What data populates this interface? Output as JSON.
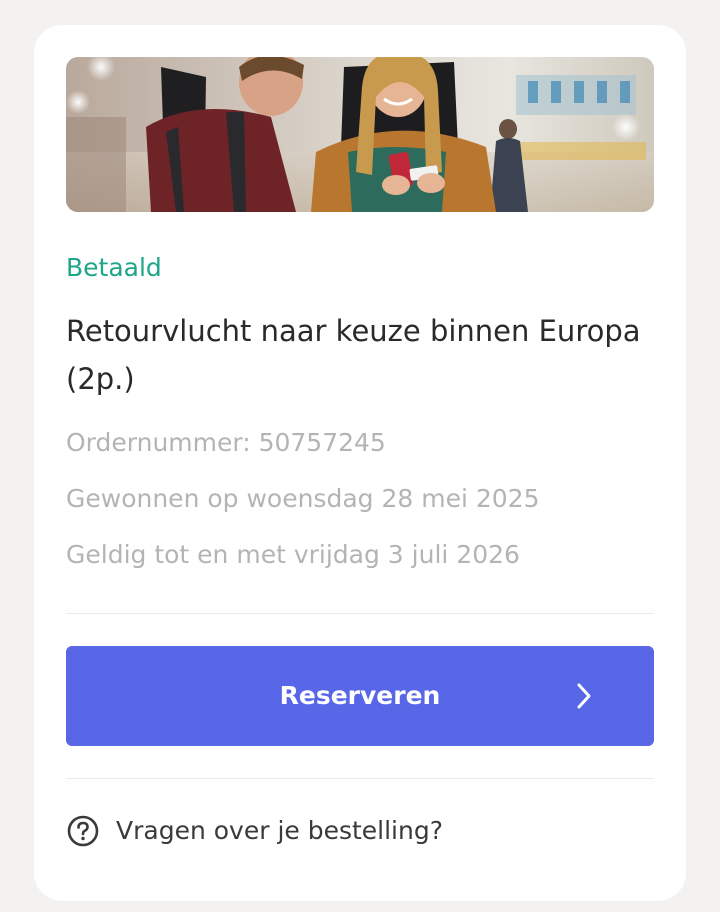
{
  "card": {
    "hero_image": "couple-at-airport-photo",
    "status": "Betaald",
    "title": "Retourvlucht naar keuze binnen Europa (2p.)",
    "order_number": "Ordernummer: 50757245",
    "won_on": "Gewonnen op woensdag 28 mei 2025",
    "valid_until": "Geldig tot en met vrijdag 3 juli 2026",
    "cta_label": "Reserveren",
    "cta_icon": "chevron-right-icon",
    "help_icon": "question-circle-icon",
    "help_text": "Vragen over je bestelling?"
  },
  "colors": {
    "accent": "#5767e8",
    "status": "#1fa58a",
    "muted_text": "#b4b4b4",
    "page_background": "#f3f2f1"
  }
}
